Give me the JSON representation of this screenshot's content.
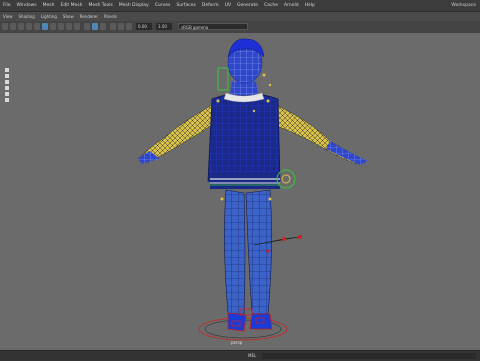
{
  "menubar": {
    "items": [
      "File",
      "Windows",
      "Mesh",
      "Edit Mesh",
      "Mesh Tools",
      "Mesh Display",
      "Curves",
      "Surfaces",
      "Deform",
      "UV",
      "Generate",
      "Cache",
      "Arnold",
      "Help"
    ],
    "workspace": "Workspace"
  },
  "panel_menu": {
    "items": [
      "View",
      "Shading",
      "Lighting",
      "Show",
      "Renderer",
      "Panels"
    ]
  },
  "toolbar": {
    "field_1": "0.00",
    "field_2": "1.00",
    "colorspace": "sRGB gamma"
  },
  "viewport": {
    "camera_label": "persp",
    "background_color": "#6b6b6b",
    "mesh_wire_color": "#2d3cff",
    "jacket_color": "#1b2a86",
    "sleeve_color": "#d9c24a",
    "control_color": "#3ac43a"
  },
  "commandline": {
    "label": "MEL"
  }
}
